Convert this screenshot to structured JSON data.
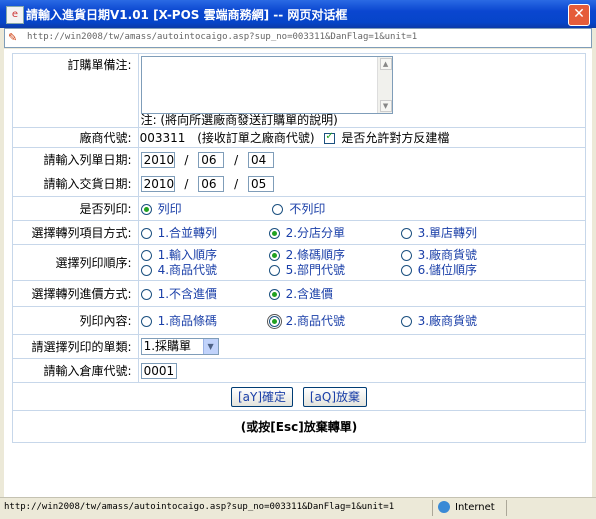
{
  "window": {
    "title": "請輸入進貨日期V1.01 [X-POS 雲端商務網] -- 网页对话框",
    "close_label": "✕"
  },
  "address": {
    "url": "http://win2008/tw/amass/autointocaigo.asp?sup_no=003311&DanFlag=1&unit=1"
  },
  "form": {
    "memo_label": "訂購單備注:",
    "memo_value": "",
    "memo_note": "注: (將向所選廠商發送訂購單的說明)",
    "supplier_label": "廠商代號:",
    "supplier_code": "003311",
    "supplier_note": "(接收訂單之廠商代號)",
    "allow_rebuild_label": "是否允許對方反建檔",
    "allow_rebuild_checked": true,
    "print_date_label": "請輸入列單日期:",
    "print_date": {
      "year": "2010",
      "month": "06",
      "day": "04"
    },
    "delivery_date_label": "請輸入交貨日期:",
    "delivery_date": {
      "year": "2010",
      "month": "06",
      "day": "05"
    },
    "date_sep": "/",
    "print_q_label": "是否列印:",
    "print_options": [
      {
        "label": "列印",
        "selected": true
      },
      {
        "label": "不列印",
        "selected": false
      }
    ],
    "convert_mode_label": "選擇轉列項目方式:",
    "convert_mode_options": [
      {
        "label": "1.合並轉列",
        "selected": false
      },
      {
        "label": "2.分店分單",
        "selected": true
      },
      {
        "label": "3.單店轉列",
        "selected": false
      }
    ],
    "print_order_label": "選擇列印順序:",
    "print_order_options": [
      {
        "label": "1.輸入順序",
        "selected": false
      },
      {
        "label": "2.條碼順序",
        "selected": true
      },
      {
        "label": "3.廠商貨號",
        "selected": false
      },
      {
        "label": "4.商品代號",
        "selected": false
      },
      {
        "label": "5.部門代號",
        "selected": false
      },
      {
        "label": "6.儲位順序",
        "selected": false
      }
    ],
    "price_mode_label": "選擇轉列進價方式:",
    "price_mode_options": [
      {
        "label": "1.不含進價",
        "selected": false
      },
      {
        "label": "2.含進價",
        "selected": true
      }
    ],
    "print_content_label": "列印內容:",
    "print_content_options": [
      {
        "label": "1.商品條碼",
        "selected": false
      },
      {
        "label": "2.商品代號",
        "selected": true
      },
      {
        "label": "3.廠商貨號",
        "selected": false
      }
    ],
    "doc_type_label": "請選擇列印的單類:",
    "doc_type_value": "1.採購單",
    "warehouse_label": "請輸入倉庫代號:",
    "warehouse_value": "0001",
    "confirm_label": "[aY]確定",
    "cancel_label": "[aQ]放棄",
    "esc_hint": "(或按[Esc]放棄轉單)"
  },
  "status": {
    "url": "http://win2008/tw/amass/autointocaigo.asp?sup_no=003311&DanFlag=1&unit=1",
    "zone": "Internet"
  }
}
